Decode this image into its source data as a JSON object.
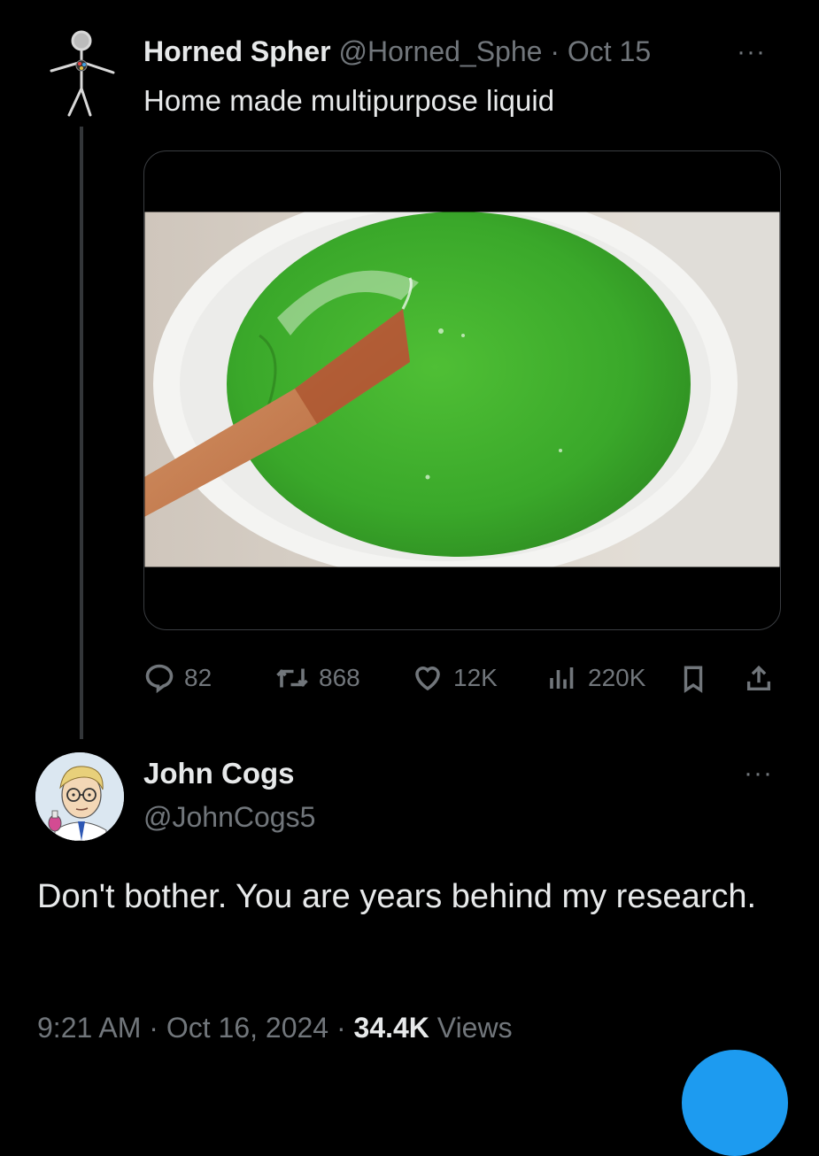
{
  "tweet": {
    "author_name": "Horned Spher",
    "author_handle": "@Horned_Sphe",
    "separator": "·",
    "date": "Oct 15",
    "more": "···",
    "text": "Home made multipurpose liquid",
    "media_icon": "bucket-green-liquid-image",
    "stats": {
      "replies": "82",
      "reposts": "868",
      "likes": "12K",
      "views": "220K"
    }
  },
  "reply": {
    "author_name": "John Cogs",
    "author_handle": "@JohnCogs5",
    "more": "···",
    "text": "Don't bother. You are years behind my research.",
    "time": "9:21 AM",
    "separator1": "·",
    "date": "Oct 16, 2024",
    "separator2": "·",
    "views_count": "34.4K",
    "views_label": "Views"
  },
  "colors": {
    "background": "#000000",
    "text_primary": "#e7e9ea",
    "text_secondary": "#71767b",
    "accent": "#1d9bf0",
    "liquid_green": "#3fae2c"
  }
}
